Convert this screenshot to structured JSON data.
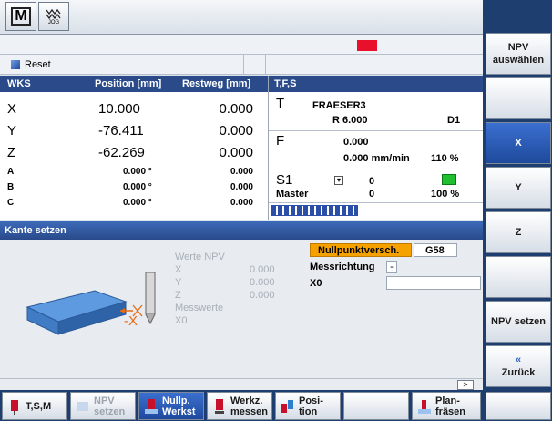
{
  "topbar": {
    "logo_label": "M",
    "jog_label": "JOG"
  },
  "reset_row": {
    "status": "Reset"
  },
  "wcs": {
    "headers": [
      "WKS",
      "Position [mm]",
      "Restweg [mm]"
    ],
    "axes": [
      {
        "name": "X",
        "pos": "10.000",
        "rest": "0.000"
      },
      {
        "name": "Y",
        "pos": "-76.411",
        "rest": "0.000"
      },
      {
        "name": "Z",
        "pos": "-62.269",
        "rest": "0.000"
      },
      {
        "name": "A",
        "pos": "0.000 °",
        "rest": "0.000"
      },
      {
        "name": "B",
        "pos": "0.000 °",
        "rest": "0.000"
      },
      {
        "name": "C",
        "pos": "0.000 °",
        "rest": "0.000"
      }
    ]
  },
  "tfs": {
    "header": "T,F,S",
    "t_label": "T",
    "tool": "FRAESER3",
    "radius": "R 6.000",
    "d": "D1",
    "f_label": "F",
    "f_value": "0.000",
    "f_rate": "0.000 mm/min",
    "f_pct": "110 %",
    "s_label": "S1",
    "s_value": "0",
    "master": "Master",
    "master_value": "0",
    "master_pct": "100 %"
  },
  "dialog": {
    "title": "Kante setzen",
    "werte_npv": "Werte NPV",
    "werte": [
      {
        "axis": "X",
        "value": "0.000"
      },
      {
        "axis": "Y",
        "value": "0.000"
      },
      {
        "axis": "Z",
        "value": "0.000"
      }
    ],
    "messwerte": "Messwerte",
    "x0_gray": "X0",
    "nullpunkt_label": "Nullpunktversch.",
    "nullpunkt_value": "G58",
    "messrichtung_label": "Messrichtung",
    "messrichtung_value": "-",
    "x0_label": "X0",
    "x0_value": "",
    "graphic_label": "-X",
    "scroll_label": ">"
  },
  "right_softkeys": [
    {
      "label": "NPV auswählen",
      "active": false
    },
    {
      "label": "",
      "active": false
    },
    {
      "label": "X",
      "active": true
    },
    {
      "label": "Y",
      "active": false
    },
    {
      "label": "Z",
      "active": false
    },
    {
      "label": "",
      "active": false
    },
    {
      "label": "NPV setzen",
      "active": false
    },
    {
      "label": "Zurück",
      "arrow": "«",
      "active": false
    },
    {
      "label": "",
      "active": false
    }
  ],
  "bottom_softkeys": [
    {
      "label": "T,S,M",
      "active": false,
      "disabled": false
    },
    {
      "label": "NPV setzen",
      "active": false,
      "disabled": true
    },
    {
      "label": "Nullp. Werkst",
      "active": true,
      "disabled": false
    },
    {
      "label": "Werkz. messen",
      "active": false,
      "disabled": false
    },
    {
      "label": "Posi- tion",
      "active": false,
      "disabled": false
    },
    {
      "label": "",
      "active": false,
      "disabled": false
    },
    {
      "label": "Plan- fräsen",
      "active": false,
      "disabled": false
    },
    {
      "label": "",
      "active": false,
      "disabled": false
    }
  ],
  "colors": {
    "accent": "#2a4a8a",
    "active_key": "#1f4a9c",
    "highlight": "#f5a200",
    "spindle_green": "#1fbf2f",
    "alarm_red": "#e8102a"
  }
}
